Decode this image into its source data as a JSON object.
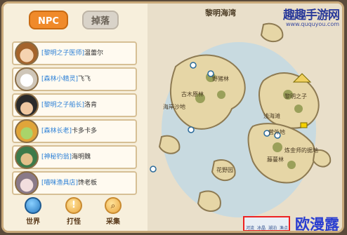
{
  "tabs": {
    "npc": "NPC",
    "drop": "掉落"
  },
  "npcs": [
    {
      "role": "[黎明之子医师]",
      "name": "温蕾尔"
    },
    {
      "role": "[森林小精灵]",
      "name": "飞飞"
    },
    {
      "role": "[黎明之子船长]",
      "name": "洛肯"
    },
    {
      "role": "[森林长老]",
      "name": "卡多卡多"
    },
    {
      "role": "[神秘钓翁]",
      "name": "海明魏"
    },
    {
      "role": "[喵咪渔具店]",
      "name": "馋老板"
    }
  ],
  "bottom_buttons": {
    "world": "世界",
    "hunt": "打怪",
    "gather": "采集"
  },
  "map": {
    "title": "黎明海湾",
    "locations": [
      "野猪林",
      "古木原林",
      "海岸沙地",
      "黎明之子",
      "浅海滩",
      "营外地",
      "炼金师的据地",
      "藤蔓林",
      "花野园"
    ],
    "legend": [
      "河流",
      "冰晶",
      "湖泊",
      "渔点"
    ]
  },
  "watermarks": {
    "top": "趣趣手游网",
    "top_url": "www.ququyou.com",
    "bottom": "欧漫露"
  },
  "colors": {
    "accent": "#f08a2a",
    "role_text": "#2a7fd6",
    "sea": "#b9d3df",
    "land": "#e6d6a6"
  }
}
